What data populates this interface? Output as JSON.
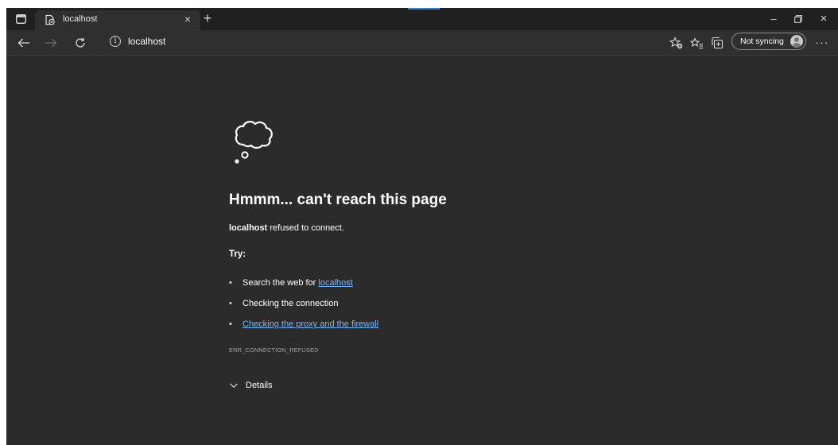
{
  "tab": {
    "title": "localhost",
    "close_glyph": "×",
    "new_tab_glyph": "+"
  },
  "window_controls": {
    "minimize_glyph": "–",
    "close_glyph": "×"
  },
  "address_bar": {
    "info_glyph": "i",
    "url": "localhost"
  },
  "profile": {
    "label": "Not syncing"
  },
  "more_glyph": "···",
  "error": {
    "heading": "Hmmm... can't reach this page",
    "host": "localhost",
    "message_suffix": " refused to connect.",
    "try_label": "Try:",
    "suggestions": {
      "search_prefix": "Search the web for ",
      "search_link": "localhost",
      "connection": "Checking the connection",
      "proxy_link": "Checking the proxy and the firewall"
    },
    "bullet": "•",
    "code": "ERR_CONNECTION_REFUSED",
    "details_label": "Details"
  },
  "colors": {
    "page_bg": "#2b2b2b",
    "tabstrip_bg": "#202020",
    "toolbar_bg": "#2f2f2f",
    "link": "#75b6ff"
  },
  "icons": {
    "tab_actions": "tab-actions-icon",
    "favicon": "page-favicon-icon",
    "back": "back-arrow-icon",
    "forward": "forward-arrow-icon",
    "refresh": "refresh-icon",
    "info": "info-icon",
    "add_favorite": "add-favorite-icon",
    "favorites": "favorites-icon",
    "collections": "collections-icon",
    "error": "thought-cloud-icon",
    "details": "chevron-down-icon"
  }
}
